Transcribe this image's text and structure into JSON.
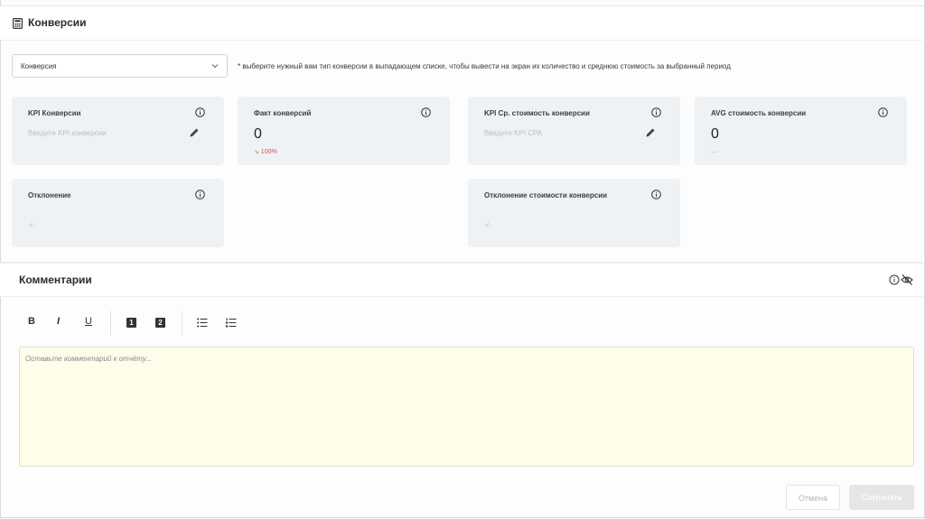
{
  "section": {
    "title": "Конверсии",
    "icon": "calculator-icon"
  },
  "conversion_select": {
    "value": "Конверсия",
    "icon": "chevron-down-icon"
  },
  "hint": "* выберите нужный вам тип конверсии в выпадающем списке, чтобы вывести на экран их количество и среднюю стоимость за выбранный период",
  "cards": {
    "kpi_conversions": {
      "label": "KPI Конверсии",
      "placeholder": "Введите KPI конверсии"
    },
    "fact_conversions": {
      "label": "Факт конверсий",
      "value": "0",
      "delta": "↘ 100%"
    },
    "kpi_avg_cost": {
      "label": "KPI Ср. стоимость конверсии",
      "placeholder": "Введите KPI CPA"
    },
    "avg_cost": {
      "label": "AVG стоимость конверсии",
      "value": "0",
      "delta": "—"
    },
    "deviation": {
      "label": "Отклонение",
      "value": "-/-"
    },
    "cost_deviation": {
      "label": "Отклонение стоимости конверсии",
      "value": "-/-"
    }
  },
  "comments": {
    "title": "Комментарии",
    "toolbar": {
      "bold": "B",
      "italic": "I",
      "underline": "U",
      "h1": "1",
      "h2": "2"
    },
    "placeholder": "Оставьте комментарий к отчёту...",
    "cancel_label": "Отмена",
    "save_label": "Сохранить"
  },
  "colors": {
    "card_bg": "#eef2f5",
    "editor_bg": "#fffcea",
    "delta_red": "#d9534f"
  }
}
